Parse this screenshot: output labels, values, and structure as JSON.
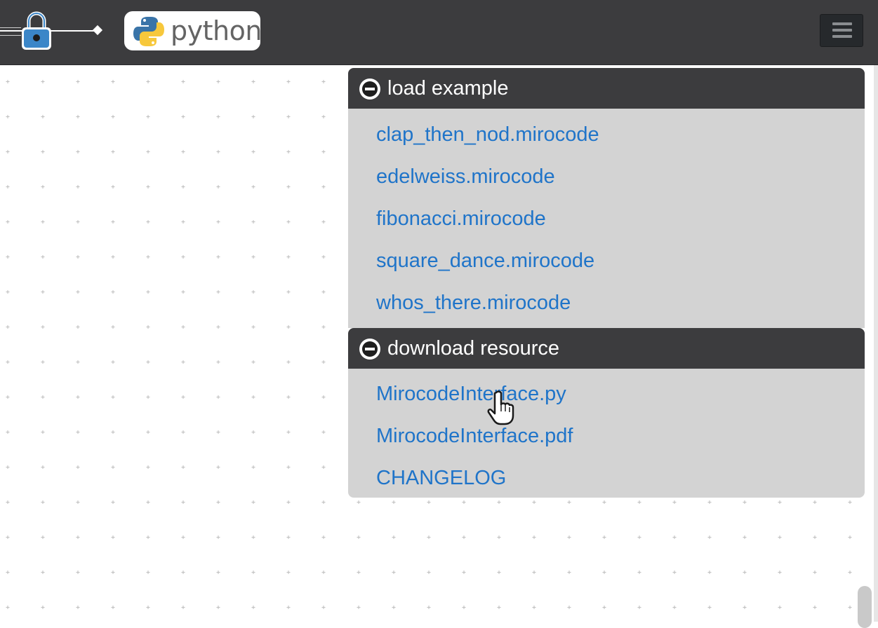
{
  "header": {
    "brand_word": "python",
    "menu_icon": "hamburger-icon",
    "lock_icon": "lock-icon"
  },
  "panels": [
    {
      "title": "load example",
      "toggle_icon": "minus-circle-icon",
      "items": [
        "clap_then_nod.mirocode",
        "edelweiss.mirocode",
        "fibonacci.mirocode",
        "square_dance.mirocode",
        "whos_there.mirocode"
      ]
    },
    {
      "title": "download resource",
      "toggle_icon": "minus-circle-icon",
      "items": [
        "MirocodeInterface.py",
        "MirocodeInterface.pdf",
        "CHANGELOG"
      ]
    }
  ],
  "colors": {
    "header_bg": "#3c3c3e",
    "panel_body_bg": "#d3d3d3",
    "link": "#1f74c9"
  }
}
